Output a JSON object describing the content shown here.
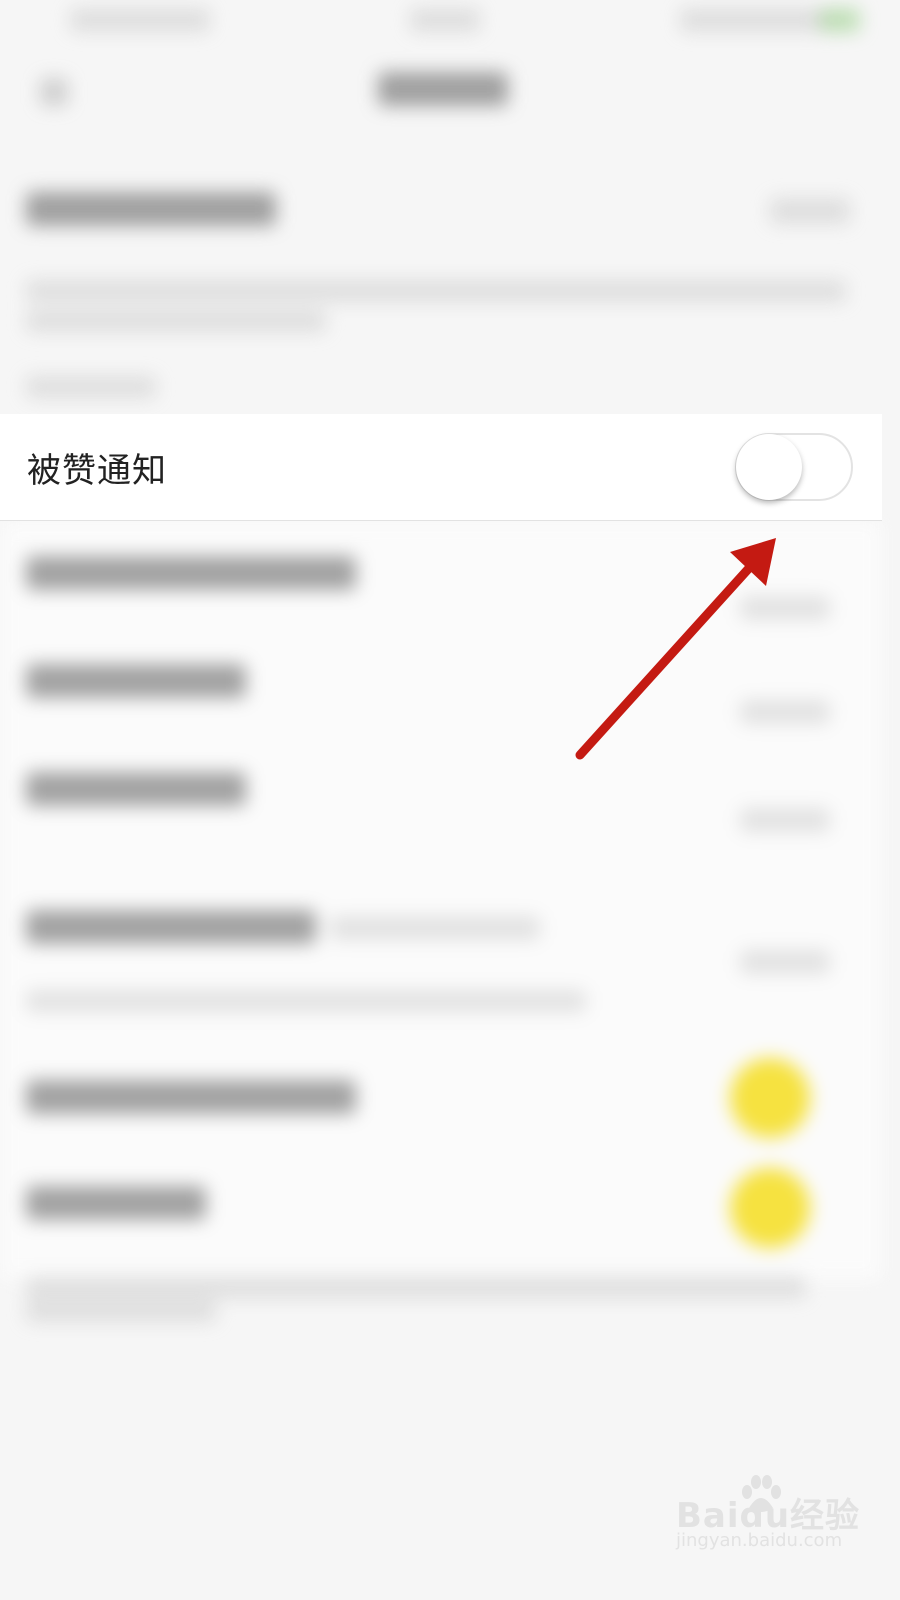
{
  "setting": {
    "label": "被赞通知",
    "enabled": false
  },
  "watermark": {
    "logo": "Baidu经验",
    "url": "jingyan.baidu.com"
  },
  "colors": {
    "arrow": "#c41a12",
    "toggle_off_track": "#ffffff",
    "blurred_toggle_on": "#f6e240"
  }
}
